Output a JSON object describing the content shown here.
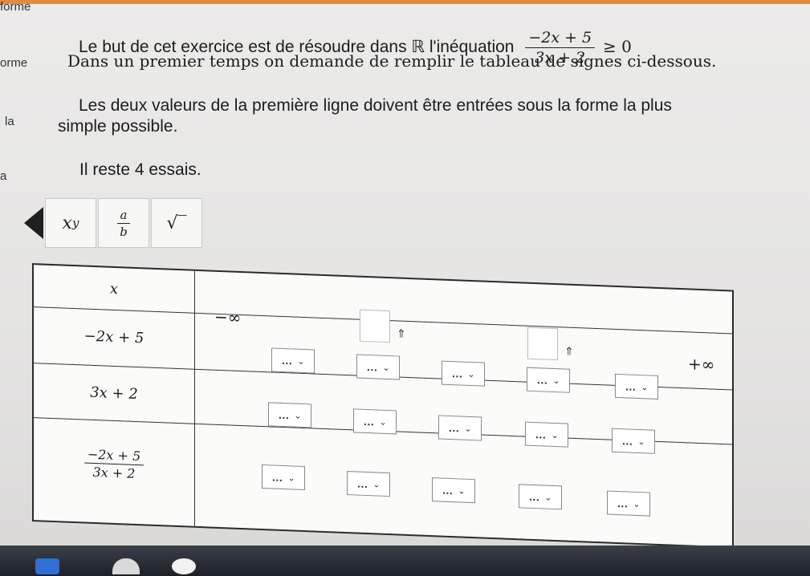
{
  "left_edge": {
    "a": "forme",
    "b": "orme",
    "c": "la",
    "d": "a"
  },
  "intro": {
    "line1_text": "Le but de cet exercice est de résoudre dans ℝ l'inéquation",
    "ineq_num": "−2x + 5",
    "ineq_den": "3x + 2",
    "ineq_rel": "≥ 0",
    "line2": "Dans un premier temps on demande de remplir le tableau de signes ci-dessous.",
    "line3": "Les deux valeurs de la première ligne doivent être entrées sous la forme la plus",
    "line4": "simple possible.",
    "attempts": "Il reste 4 essais."
  },
  "toolbar": {
    "power_label": "x",
    "power_sup": "y",
    "frac_num": "a",
    "frac_den": "b",
    "sqrt_label": "√‾"
  },
  "table": {
    "x_label": "x",
    "minus_inf": "−∞",
    "plus_inf": "+∞",
    "row1_label": "−2x + 5",
    "row2_label": "3x + 2",
    "row3_num": "−2x + 5",
    "row3_den": "3x + 2",
    "dropdown_dots": "…",
    "dropdown_chevron": "⌄",
    "up_arrow": "⇑"
  },
  "icons": [
    "arrow-left-icon",
    "up-arrow-icon",
    "chevron-down-icon"
  ],
  "colors": {
    "accent": "#e48a3c"
  }
}
